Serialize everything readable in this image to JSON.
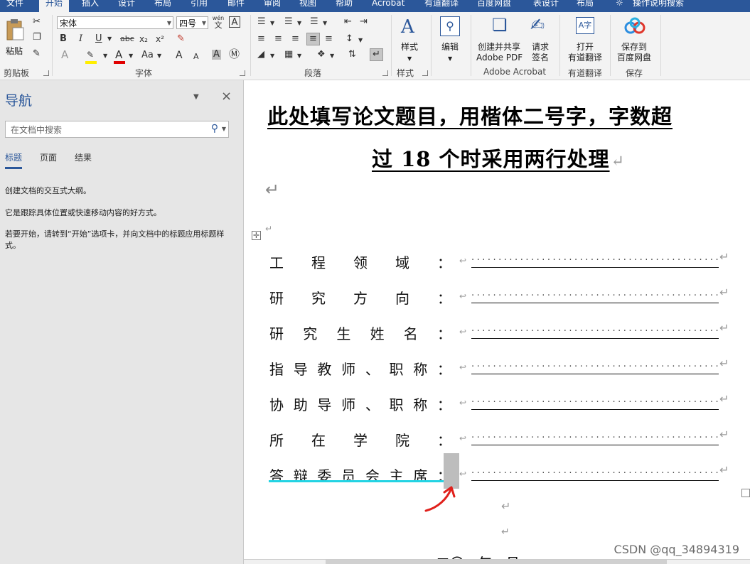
{
  "tabs": [
    "文件",
    "开始",
    "插入",
    "设计",
    "布局",
    "引用",
    "邮件",
    "审阅",
    "视图",
    "帮助",
    "Acrobat",
    "有道翻译",
    "百度网盘",
    "表设计",
    "布局",
    "操作说明搜索"
  ],
  "ribbon": {
    "paste_label": "粘贴",
    "clipboard_group": "剪贴板",
    "font_name": "宋体",
    "font_size": "四号",
    "font_group": "字体",
    "wen_char": "wén",
    "wen_base": "文",
    "para_group": "段落",
    "styles_label": "样式",
    "styles_group": "样式",
    "edit_label": "编辑",
    "adobe_create_l1": "创建并共享",
    "adobe_create_l2": "Adobe PDF",
    "adobe_sign_l1": "请求",
    "adobe_sign_l2": "签名",
    "adobe_group": "Adobe Acrobat",
    "youdao_open_l1": "打开",
    "youdao_open_l2": "有道翻译",
    "youdao_group": "有道翻译",
    "baidu_save_l1": "保存到",
    "baidu_save_l2": "百度网盘",
    "baidu_group": "保存",
    "btn_bold": "B",
    "btn_italic": "I",
    "btn_underline": "U",
    "btn_strike": "abc",
    "btn_sub": "x₂",
    "btn_sup": "x²",
    "btn_clear": "A",
    "btn_aa": "Aa",
    "btn_grow": "A",
    "btn_shrink": "A"
  },
  "nav": {
    "title": "导航",
    "search_placeholder": "在文档中搜索",
    "tabs": [
      "标题",
      "页面",
      "结果"
    ],
    "messages": [
      "创建文档的交互式大纲。",
      "它是跟踪具体位置或快速移动内容的好方式。",
      "若要开始，请转到“开始”选项卡，并向文档中的标题应用标题样式。"
    ]
  },
  "document": {
    "title_line1": "此处填写论文题目，用楷体二号字，字数超",
    "title_line2": "过 18 个时采用两行处理",
    "rows": [
      {
        "label": "工程领域："
      },
      {
        "label": "研究方向："
      },
      {
        "label": "研究生姓名："
      },
      {
        "label": "指导教师、职称："
      },
      {
        "label": "协助导师、职称："
      },
      {
        "label": "所在学院："
      },
      {
        "label": "答辩委员会主席："
      }
    ],
    "bottom_text": "二〇   年   月"
  },
  "watermark": "CSDN @qq_34894319",
  "colors": {
    "accent": "#2b579a",
    "annotation": "#e0201b",
    "cyan_underline": "#23d3e3"
  }
}
